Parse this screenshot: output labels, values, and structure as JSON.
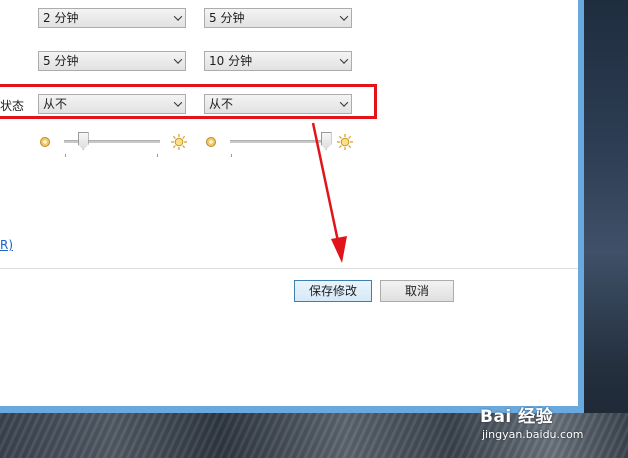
{
  "dropdowns": {
    "row1": {
      "left": "2 分钟",
      "right": "5 分钟"
    },
    "row2": {
      "left": "5 分钟",
      "right": "10 分钟"
    },
    "row3": {
      "left": "从不",
      "right": "从不"
    }
  },
  "row3_label_fragment": "状态:",
  "brightness": {
    "left_slider_level_fraction": 0.2,
    "right_slider_level_fraction": 1.0
  },
  "link_fragment": "R)",
  "buttons": {
    "save": "保存修改",
    "cancel": "取消"
  },
  "watermark": {
    "brand": "Bai 经验",
    "url": "jingyan.baidu.com"
  },
  "colors": {
    "highlight": "#e2141b",
    "arrow": "#e2141b",
    "window_border": "#6aa9de",
    "link": "#1a63c7"
  }
}
